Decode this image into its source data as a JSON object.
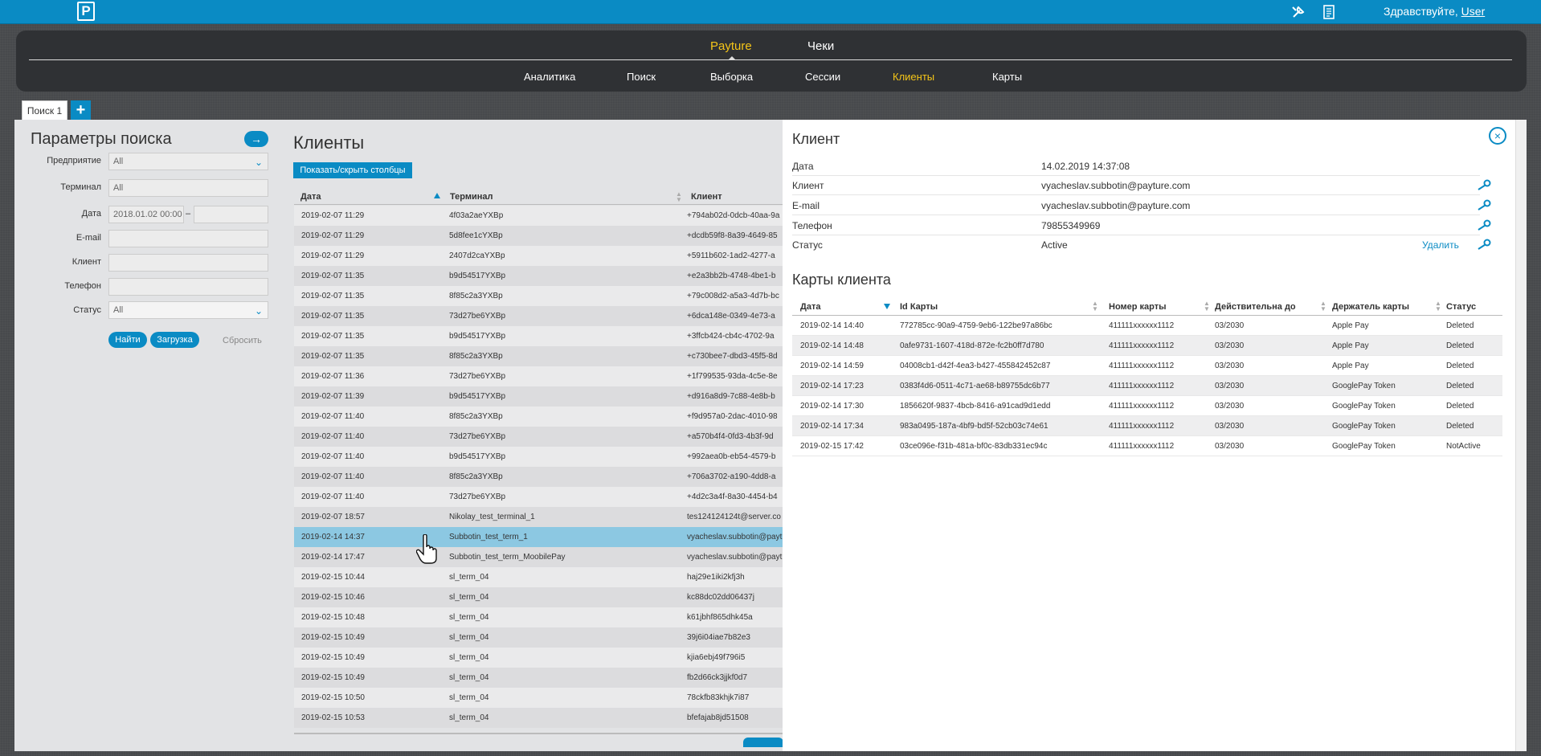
{
  "topbar": {
    "logo": "P",
    "greeting": "Здравствуйте,",
    "user": "User"
  },
  "nav": {
    "top": [
      {
        "label": "Payture",
        "active": true
      },
      {
        "label": "Чеки",
        "active": false
      }
    ],
    "sub": [
      {
        "label": "Аналитика",
        "active": false
      },
      {
        "label": "Поиск",
        "active": false
      },
      {
        "label": "Выборка",
        "active": false
      },
      {
        "label": "Сессии",
        "active": false
      },
      {
        "label": "Клиенты",
        "active": true
      },
      {
        "label": "Карты",
        "active": false
      }
    ]
  },
  "tabs": {
    "search_tab": "Поиск 1",
    "add_label": "+"
  },
  "search": {
    "title": "Параметры поиска",
    "arrow": "→",
    "enterprise_label": "Предприятие",
    "enterprise_value": "All",
    "terminal_label": "Терминал",
    "terminal_placeholder": "All",
    "date_label": "Дата",
    "date_from": "2018.01.02 00:00",
    "date_sep": "–",
    "date_to": "",
    "email_label": "E-mail",
    "email_value": "",
    "client_label": "Клиент",
    "client_value": "",
    "phone_label": "Телефон",
    "phone_value": "",
    "status_label": "Статус",
    "status_value": "All",
    "find_button": "Найти",
    "load_button": "Загрузка",
    "reset_button": "Сбросить"
  },
  "clients": {
    "title": "Клиенты",
    "toggle_columns": "Показать/скрыть столбцы",
    "columns": {
      "date": "Дата",
      "terminal": "Терминал",
      "client": "Клиент"
    },
    "rows": [
      {
        "date": "2019-02-07 11:29",
        "terminal": "4f03a2aeYXBp",
        "client": "+794ab02d-0dcb-40aa-9a"
      },
      {
        "date": "2019-02-07 11:29",
        "terminal": "5d8fee1cYXBp",
        "client": "+dcdb59f8-8a39-4649-85"
      },
      {
        "date": "2019-02-07 11:29",
        "terminal": "2407d2caYXBp",
        "client": "+5911b602-1ad2-4277-a"
      },
      {
        "date": "2019-02-07 11:35",
        "terminal": "b9d54517YXBp",
        "client": "+e2a3bb2b-4748-4be1-b"
      },
      {
        "date": "2019-02-07 11:35",
        "terminal": "8f85c2a3YXBp",
        "client": "+79c008d2-a5a3-4d7b-bc"
      },
      {
        "date": "2019-02-07 11:35",
        "terminal": "73d27be6YXBp",
        "client": "+6dca148e-0349-4e73-a"
      },
      {
        "date": "2019-02-07 11:35",
        "terminal": "b9d54517YXBp",
        "client": "+3ffcb424-cb4c-4702-9a"
      },
      {
        "date": "2019-02-07 11:35",
        "terminal": "8f85c2a3YXBp",
        "client": "+c730bee7-dbd3-45f5-8d"
      },
      {
        "date": "2019-02-07 11:36",
        "terminal": "73d27be6YXBp",
        "client": "+1f799535-93da-4c5e-8e"
      },
      {
        "date": "2019-02-07 11:39",
        "terminal": "b9d54517YXBp",
        "client": "+d916a8d9-7c88-4e8b-b"
      },
      {
        "date": "2019-02-07 11:40",
        "terminal": "8f85c2a3YXBp",
        "client": "+f9d957a0-2dac-4010-98"
      },
      {
        "date": "2019-02-07 11:40",
        "terminal": "73d27be6YXBp",
        "client": "+a570b4f4-0fd3-4b3f-9d"
      },
      {
        "date": "2019-02-07 11:40",
        "terminal": "b9d54517YXBp",
        "client": "+992aea0b-eb54-4579-b"
      },
      {
        "date": "2019-02-07 11:40",
        "terminal": "8f85c2a3YXBp",
        "client": "+706a3702-a190-4dd8-a"
      },
      {
        "date": "2019-02-07 11:40",
        "terminal": "73d27be6YXBp",
        "client": "+4d2c3a4f-8a30-4454-b4"
      },
      {
        "date": "2019-02-07 18:57",
        "terminal": "Nikolay_test_terminal_1",
        "client": "tes124124124t@server.co"
      },
      {
        "date": "2019-02-14 14:37",
        "terminal": "Subbotin_test_term_1",
        "client": "vyacheslav.subbotin@payt",
        "selected": true
      },
      {
        "date": "2019-02-14 17:47",
        "terminal": "Subbotin_test_term_MoobilePay",
        "client": "vyacheslav.subbotin@payt"
      },
      {
        "date": "2019-02-15 10:44",
        "terminal": "sl_term_04",
        "client": "haj29e1iki2kfj3h"
      },
      {
        "date": "2019-02-15 10:46",
        "terminal": "sl_term_04",
        "client": "kc88dc02dd06437j"
      },
      {
        "date": "2019-02-15 10:48",
        "terminal": "sl_term_04",
        "client": "k61jbhf865dhk45a"
      },
      {
        "date": "2019-02-15 10:49",
        "terminal": "sl_term_04",
        "client": "39j6i04iae7b82e3"
      },
      {
        "date": "2019-02-15 10:49",
        "terminal": "sl_term_04",
        "client": "kjia6ebj49f796i5"
      },
      {
        "date": "2019-02-15 10:49",
        "terminal": "sl_term_04",
        "client": "fb2d66ck3jjkf0d7"
      },
      {
        "date": "2019-02-15 10:50",
        "terminal": "sl_term_04",
        "client": "78ckfb83khjk7i87"
      },
      {
        "date": "2019-02-15 10:53",
        "terminal": "sl_term_04",
        "client": "bfefajab8jd51508"
      }
    ]
  },
  "detail": {
    "title": "Клиент",
    "close": "×",
    "date_label": "Дата",
    "date_value": "14.02.2019 14:37:08",
    "client_label": "Клиент",
    "client_value": "vyacheslav.subbotin@payture.com",
    "email_label": "E-mail",
    "email_value": "vyacheslav.subbotin@payture.com",
    "phone_label": "Телефон",
    "phone_value": "79855349969",
    "status_label": "Статус",
    "status_value": "Active",
    "delete_label": "Удалить",
    "cards_title": "Карты клиента",
    "card_columns": {
      "date": "Дата",
      "id": "Id Карты",
      "number": "Номер карты",
      "valid": "Действительна до",
      "holder": "Держатель карты",
      "status": "Статус"
    },
    "cards": [
      {
        "date": "2019-02-14 14:40",
        "id": "772785cc-90a9-4759-9eb6-122be97a86bc",
        "number": "411111xxxxxx1112",
        "valid": "03/2030",
        "holder": "Apple Pay",
        "status": "Deleted"
      },
      {
        "date": "2019-02-14 14:48",
        "id": "0afe9731-1607-418d-872e-fc2b0ff7d780",
        "number": "411111xxxxxx1112",
        "valid": "03/2030",
        "holder": "Apple Pay",
        "status": "Deleted"
      },
      {
        "date": "2019-02-14 14:59",
        "id": "04008cb1-d42f-4ea3-b427-455842452c87",
        "number": "411111xxxxxx1112",
        "valid": "03/2030",
        "holder": "Apple Pay",
        "status": "Deleted"
      },
      {
        "date": "2019-02-14 17:23",
        "id": "0383f4d6-0511-4c71-ae68-b89755dc6b77",
        "number": "411111xxxxxx1112",
        "valid": "03/2030",
        "holder": "GooglePay Token",
        "status": "Deleted"
      },
      {
        "date": "2019-02-14 17:30",
        "id": "1856620f-9837-4bcb-8416-a91cad9d1edd",
        "number": "411111xxxxxx1112",
        "valid": "03/2030",
        "holder": "GooglePay Token",
        "status": "Deleted"
      },
      {
        "date": "2019-02-14 17:34",
        "id": "983a0495-187a-4bf9-bd5f-52cb03c74e61",
        "number": "411111xxxxxx1112",
        "valid": "03/2030",
        "holder": "GooglePay Token",
        "status": "Deleted"
      },
      {
        "date": "2019-02-15 17:42",
        "id": "03ce096e-f31b-481a-bf0c-83db331ec94c",
        "number": "411111xxxxxx1112",
        "valid": "03/2030",
        "holder": "GooglePay Token",
        "status": "NotActive"
      }
    ]
  },
  "colors": {
    "accent": "#0a8bc4",
    "active_nav": "#f5c518",
    "selected_row": "#8cc8e2"
  },
  "icons": {
    "settings": "tools-icon",
    "report": "notepad-icon",
    "key": "key-icon",
    "cursor": "hand-cursor-icon"
  }
}
